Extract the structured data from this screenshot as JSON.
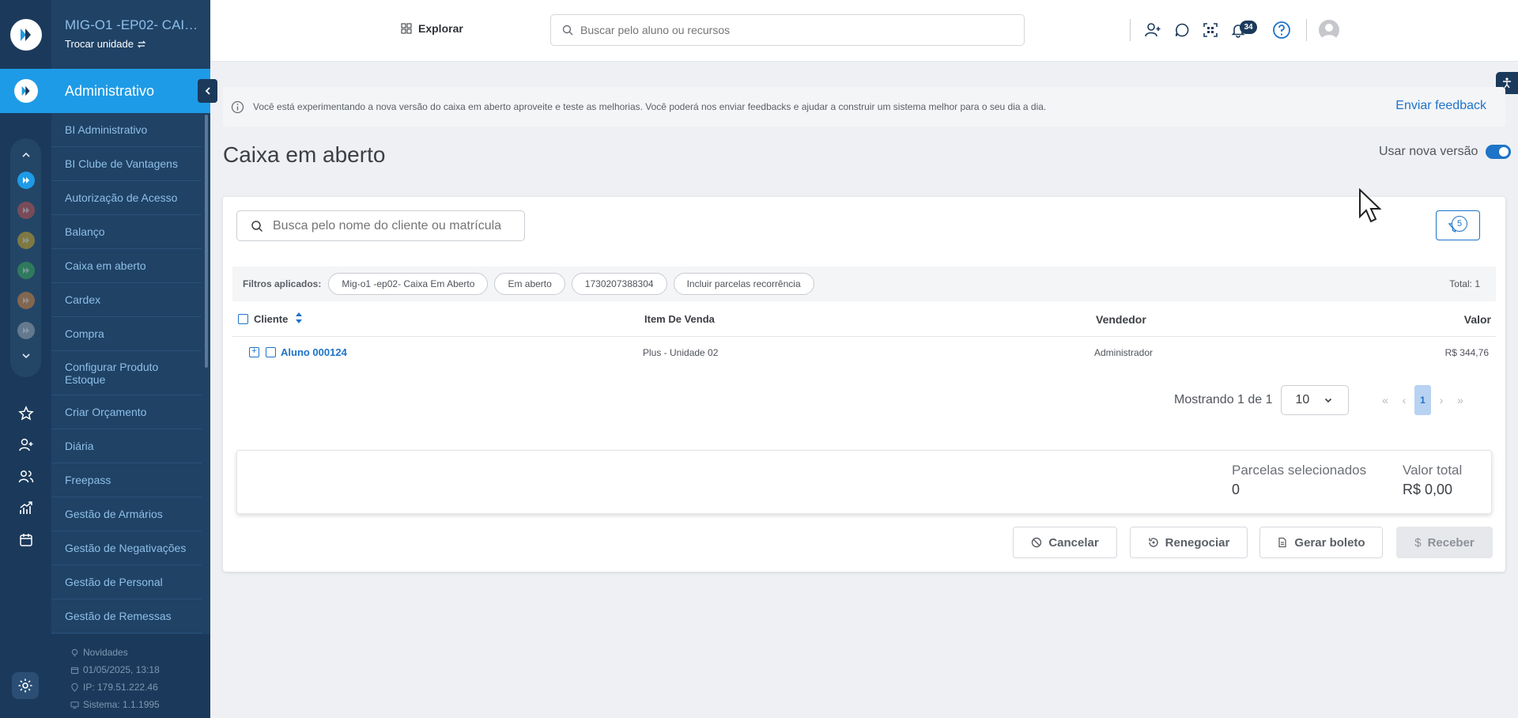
{
  "sidebar": {
    "unit_name": "MIG-O1 -EP02- CAIX...",
    "unit_switch": "Trocar unidade",
    "section_title": "Administrativo",
    "items": [
      {
        "label": "BI Administrativo"
      },
      {
        "label": "BI Clube de Vantagens"
      },
      {
        "label": "Autorização de Acesso"
      },
      {
        "label": "Balanço"
      },
      {
        "label": "Caixa em aberto"
      },
      {
        "label": "Cardex"
      },
      {
        "label": "Compra"
      },
      {
        "label": "Configurar Produto Estoque"
      },
      {
        "label": "Criar Orçamento"
      },
      {
        "label": "Diária"
      },
      {
        "label": "Freepass"
      },
      {
        "label": "Gestão de Armários"
      },
      {
        "label": "Gestão de Negativações"
      },
      {
        "label": "Gestão de Personal"
      },
      {
        "label": "Gestão de Remessas"
      }
    ],
    "footer": {
      "news": "Novidades",
      "date": "01/05/2025, 13:18",
      "ip": "IP: 179.51.222.46",
      "system": "Sistema: 1.1.1995"
    },
    "module_colors": [
      "#1e9be6",
      "#c0504d",
      "#c9a227",
      "#3aa655",
      "#d0823a",
      "#9aa3ad"
    ]
  },
  "header": {
    "explore_label": "Explorar",
    "search_placeholder": "Buscar pelo aluno ou recursos",
    "notifications_count": "34"
  },
  "banner": {
    "text": "Você está experimentando a nova versão do caixa em aberto aproveite e teste as melhorias. Você poderá nos enviar feedbacks e ajudar a construir um sistema melhor para o seu dia a dia.",
    "link": "Enviar feedback"
  },
  "page": {
    "title": "Caixa em aberto",
    "new_version_label": "Usar nova versão",
    "new_version_on": true
  },
  "filters": {
    "search_placeholder": "Busca pelo nome do cliente ou matrícula",
    "count": "5",
    "applied_label": "Filtros aplicados:",
    "chips": [
      "Mig-o1 -ep02- Caixa Em Aberto",
      "Em aberto",
      "1730207388304",
      "Incluir parcelas recorrência"
    ],
    "total": "Total: 1"
  },
  "table": {
    "columns": {
      "client": "Cliente",
      "item": "Item De Venda",
      "seller": "Vendedor",
      "value": "Valor"
    },
    "rows": [
      {
        "client": "Aluno 000124",
        "item": "Plus - Unidade 02",
        "seller": "Administrador",
        "value": "R$ 344,76"
      }
    ]
  },
  "pagination": {
    "showing": "Mostrando 1 de 1",
    "page_size": "10",
    "current_page": "1"
  },
  "summary": {
    "selected_label": "Parcelas selecionados",
    "selected_value": "0",
    "total_label": "Valor total",
    "total_value": "R$ 0,00"
  },
  "actions": {
    "cancel": "Cancelar",
    "renegotiate": "Renegociar",
    "boleto": "Gerar boleto",
    "receive": "Receber"
  },
  "colors": {
    "primary": "#1e74c8",
    "sidebar_dark": "#1b3a5b",
    "sidebar": "#1f4265",
    "accent": "#1e9be6"
  }
}
